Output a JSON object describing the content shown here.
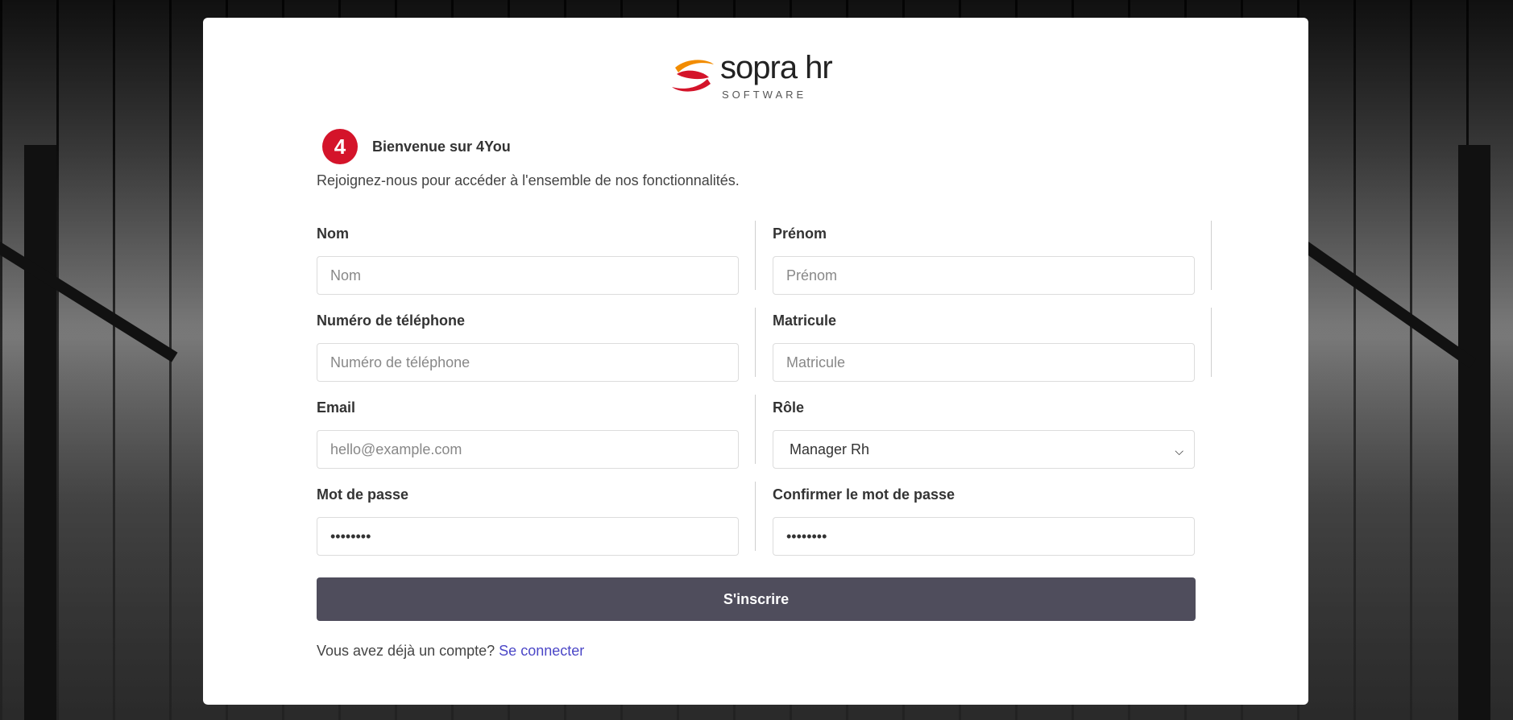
{
  "brand": {
    "name": "sopra hr",
    "subname": "SOFTWARE"
  },
  "welcome": {
    "badge": "4",
    "title": "Bienvenue sur 4You",
    "subtitle": "Rejoignez-nous pour accéder à l'ensemble de nos fonctionnalités."
  },
  "form": {
    "nom": {
      "label": "Nom",
      "placeholder": "Nom",
      "value": ""
    },
    "prenom": {
      "label": "Prénom",
      "placeholder": "Prénom",
      "value": ""
    },
    "telephone": {
      "label": "Numéro de téléphone",
      "placeholder": "Numéro de téléphone",
      "value": ""
    },
    "matricule": {
      "label": "Matricule",
      "placeholder": "Matricule",
      "value": ""
    },
    "email": {
      "label": "Email",
      "placeholder": "hello@example.com",
      "value": ""
    },
    "role": {
      "label": "Rôle",
      "selected": "Manager Rh"
    },
    "password": {
      "label": "Mot de passe",
      "value": "••••••••"
    },
    "confirm_password": {
      "label": "Confirmer le mot de passe",
      "value": "••••••••"
    },
    "submit_label": "S'inscrire"
  },
  "footer": {
    "text": "Vous avez déjà un compte?",
    "link": "Se connecter"
  },
  "colors": {
    "submit_bg": "#4f4d5c",
    "link": "#4b47c7",
    "brand_red": "#d4142a",
    "brand_orange": "#f28c00"
  }
}
